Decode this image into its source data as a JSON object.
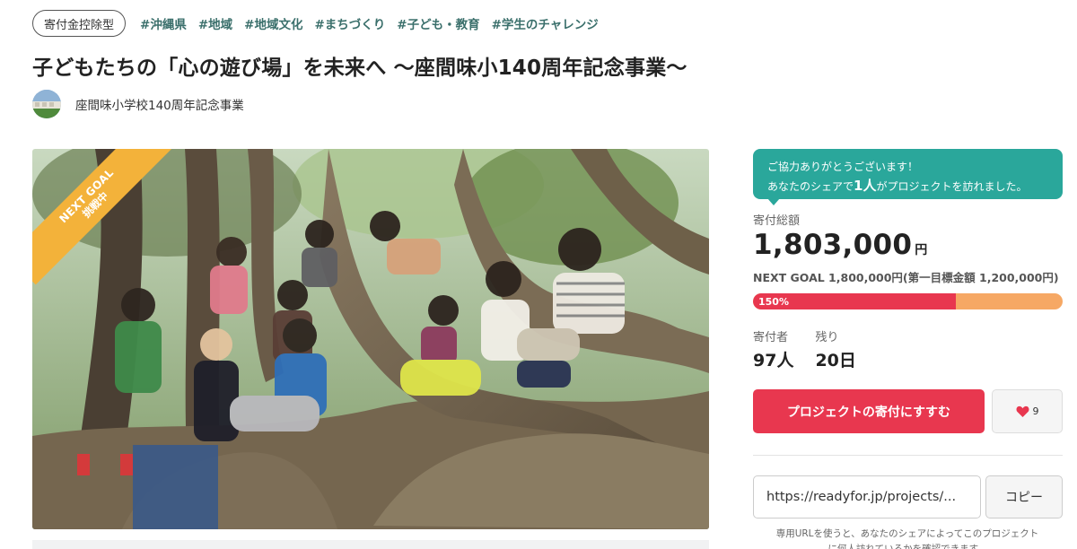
{
  "tags": {
    "badge": "寄付金控除型",
    "hashtags": [
      "#沖縄県",
      "#地域",
      "#地域文化",
      "#まちづくり",
      "#子ども・教育",
      "#学生のチャレンジ"
    ]
  },
  "project": {
    "title": "子どもたちの「心の遊び場」を未来へ 〜座間味小140周年記念事業〜",
    "owner": "座間味小学校140周年記念事業"
  },
  "hero": {
    "ribbon_line1": "NEXT GOAL",
    "ribbon_line2": "挑戦中",
    "ribbon_color": "#f3b23a"
  },
  "sidebar": {
    "thanks_line1": "ご協力ありがとうございます！",
    "thanks_pre": "あなたのシェアで",
    "thanks_count": "1人",
    "thanks_post": "がプロジェクトを訪れました。",
    "amount_label": "寄付総額",
    "amount_value": "1,803,000",
    "amount_unit": "円",
    "goal_text": "NEXT GOAL 1,800,000円(第一目標金額 1,200,000円)",
    "progress_label": "150%",
    "progress_fraction": 0.655,
    "donors_label": "寄付者",
    "donors_value": "97人",
    "remaining_label": "残り",
    "remaining_value": "20日",
    "support_button": "プロジェクトの寄付にすすむ",
    "favorite_count": "9",
    "share_url": "https://readyfor.jp/projects/...",
    "copy_button": "コピー",
    "share_note": "専用URLを使うと、あなたのシェアによってこのプロジェクトに何人訪れているかを確認できます。"
  },
  "colors": {
    "accent_red": "#e8374f",
    "progress_remaining": "#f6a864",
    "teal": "#2aa79b",
    "hashtag": "#3a6f6b"
  },
  "icons": {
    "favorite": "heart-icon"
  }
}
